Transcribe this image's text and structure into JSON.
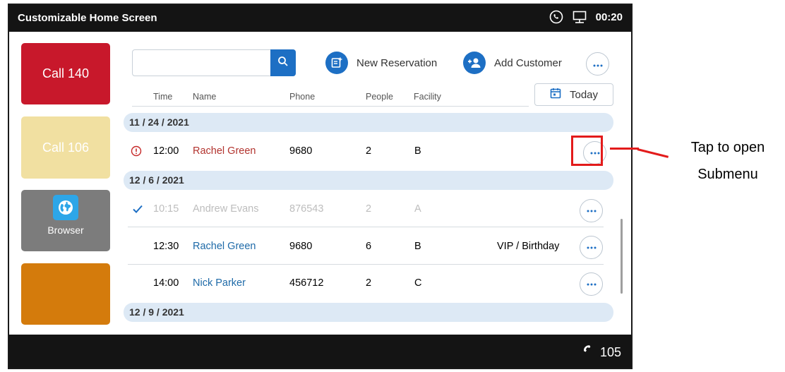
{
  "topbar": {
    "title": "Customizable Home Screen",
    "time": "00:20"
  },
  "bottombar": {
    "extension": "105"
  },
  "tiles": {
    "call140": "Call 140",
    "call106": "Call 106",
    "browser": "Browser"
  },
  "search": {
    "placeholder": "",
    "value": ""
  },
  "actions": {
    "new_reservation": "New Reservation",
    "add_customer": "Add Customer"
  },
  "headers": {
    "time": "Time",
    "name": "Name",
    "phone": "Phone",
    "people": "People",
    "facility": "Facility"
  },
  "today_label": "Today",
  "groups": [
    {
      "date": "11 / 24 / 2021",
      "rows": [
        {
          "status": "alert",
          "time": "12:00",
          "name": "Rachel Green",
          "phone": "9680",
          "people": "2",
          "facility": "B",
          "note": ""
        }
      ]
    },
    {
      "date": "12 / 6 / 2021",
      "rows": [
        {
          "status": "done",
          "time": "10:15",
          "name": "Andrew Evans",
          "phone": "876543",
          "people": "2",
          "facility": "A",
          "note": ""
        },
        {
          "status": "",
          "time": "12:30",
          "name": "Rachel Green",
          "phone": "9680",
          "people": "6",
          "facility": "B",
          "note": "VIP / Birthday"
        },
        {
          "status": "",
          "time": "14:00",
          "name": "Nick Parker",
          "phone": "456712",
          "people": "2",
          "facility": "C",
          "note": ""
        }
      ]
    },
    {
      "date": "12 / 9 / 2021",
      "rows": []
    }
  ],
  "callout": {
    "line1": "Tap to open",
    "line2": "Submenu"
  },
  "colors": {
    "accent": "#1d6fc4",
    "highlight": "#e31b1b",
    "call140": "#c8182b",
    "call106": "#f1e0a1",
    "browser": "#7c7c7c",
    "orange": "#d47b0c"
  }
}
